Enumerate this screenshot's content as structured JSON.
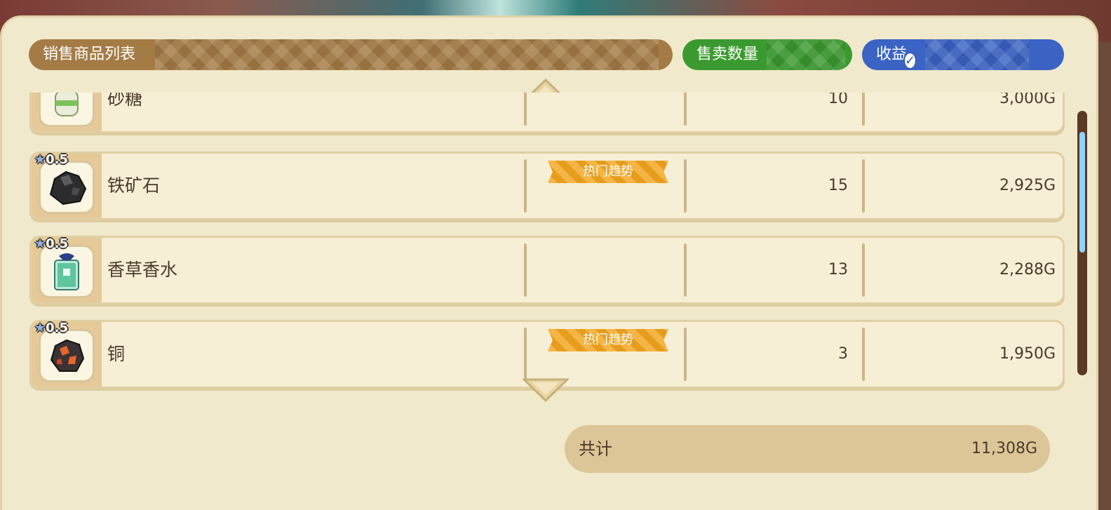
{
  "header": {
    "list_label": "销售商品列表",
    "qty_label": "售卖数量",
    "revenue_label": "收益",
    "revenue_checked": true
  },
  "items": [
    {
      "name": "砂糖",
      "rank": "",
      "qty": "10",
      "value": "3,000G",
      "trending": false,
      "icon": "sugar-jar-icon"
    },
    {
      "name": "铁矿石",
      "rank": "0.5",
      "qty": "15",
      "value": "2,925G",
      "trending": true,
      "icon": "iron-ore-icon"
    },
    {
      "name": "香草香水",
      "rank": "0.5",
      "qty": "13",
      "value": "2,288G",
      "trending": false,
      "icon": "perfume-bottle-icon"
    },
    {
      "name": "铜",
      "rank": "0.5",
      "qty": "3",
      "value": "1,950G",
      "trending": true,
      "icon": "copper-ore-icon"
    }
  ],
  "trending_label": "热门趋势",
  "total": {
    "label": "共计",
    "amount": "11,308G"
  },
  "colors": {
    "list_header": "#a47b45",
    "qty_header": "#3b9a2f",
    "revenue_header": "#3a63c4",
    "trending_badge": "#f2a51d"
  }
}
